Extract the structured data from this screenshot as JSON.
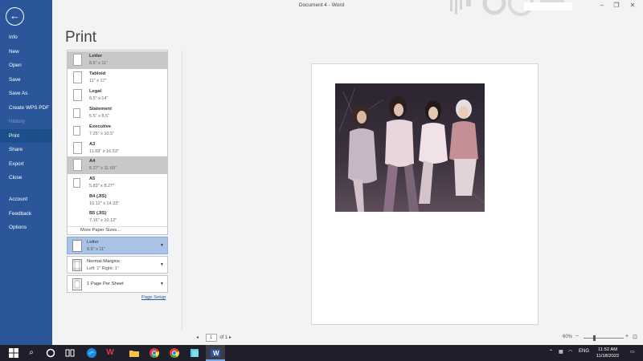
{
  "window": {
    "title": "Document 4  -  Word",
    "minimize_icon": "minimize-icon",
    "restore_icon": "restore-icon",
    "close_icon": "close-icon"
  },
  "sidebar": {
    "back_icon": "back-arrow-icon",
    "items": [
      {
        "label": "Info",
        "state": "normal"
      },
      {
        "label": "New",
        "state": "normal"
      },
      {
        "label": "Open",
        "state": "normal"
      },
      {
        "label": "Save",
        "state": "normal"
      },
      {
        "label": "Save As",
        "state": "normal"
      },
      {
        "label": "Create WPS PDF",
        "state": "normal"
      },
      {
        "label": "History",
        "state": "disabled"
      },
      {
        "label": "Print",
        "state": "active"
      },
      {
        "label": "Share",
        "state": "normal"
      },
      {
        "label": "Export",
        "state": "normal"
      },
      {
        "label": "Close",
        "state": "normal"
      },
      {
        "label": "Account",
        "state": "normal"
      },
      {
        "label": "Feedback",
        "state": "normal"
      },
      {
        "label": "Options",
        "state": "normal"
      }
    ]
  },
  "main": {
    "heading": "Print",
    "paper_sizes": [
      {
        "name": "Letter",
        "dims": "8.5\" x 11\""
      },
      {
        "name": "Tabloid",
        "dims": "11\" x 17\""
      },
      {
        "name": "Legal",
        "dims": "8.5\" x 14\""
      },
      {
        "name": "Statement",
        "dims": "5.5\" x 8.5\""
      },
      {
        "name": "Executive",
        "dims": "7.25\" x 10.5\""
      },
      {
        "name": "A3",
        "dims": "11.69\" x 16.53\""
      },
      {
        "name": "A4",
        "dims": "8.27\" x 11.69\""
      },
      {
        "name": "A5",
        "dims": "5.83\" x 8.27\""
      },
      {
        "name": "B4 (JIS)",
        "dims": "10.12\" x 14.33\""
      },
      {
        "name": "B5 (JIS)",
        "dims": "7.16\" x 10.12\""
      }
    ],
    "more_paper_sizes": "More Paper Sizes...",
    "paper_setting": {
      "line1": "Letter",
      "line2": "8.5\" x 11\""
    },
    "margins_setting": {
      "line1": "Normal Margins",
      "line2": "Left:  1\"    Right:  1\""
    },
    "pages_per_sheet": {
      "line1": "1 Page Per Sheet"
    },
    "page_setup_link": "Page Setup"
  },
  "pager": {
    "prev_icon": "prev-page-icon",
    "current": "1",
    "of_text": "of 1",
    "next_icon": "next-page-icon"
  },
  "zoom": {
    "level": "60%",
    "minus": "−",
    "plus": "+",
    "fit_icon": "zoom-to-page-icon"
  },
  "taskbar": {
    "lang": "ENG",
    "time": "11:52 AM",
    "date": "11/18/2022"
  }
}
